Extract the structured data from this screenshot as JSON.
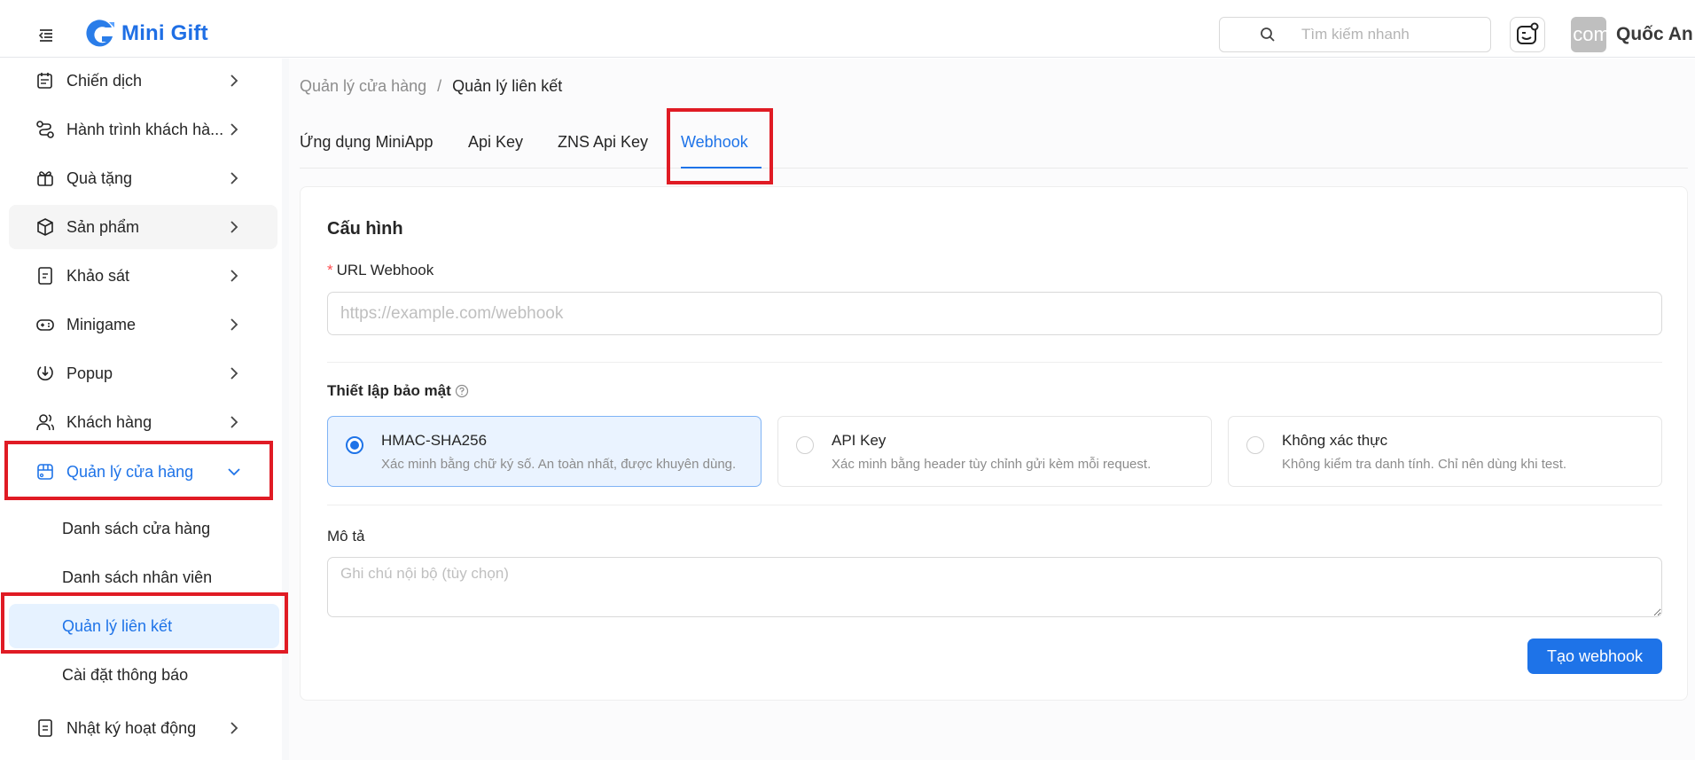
{
  "header": {
    "app_name": "Mini Gift",
    "search_placeholder": "Tìm kiếm nhanh",
    "avatar_text": "com",
    "user_name": "Quốc An"
  },
  "sidebar": {
    "items": [
      {
        "label": "Chiến dịch",
        "icon": "campaign-icon"
      },
      {
        "label": "Hành trình khách hà...",
        "icon": "journey-icon"
      },
      {
        "label": "Quà tặng",
        "icon": "gift-icon"
      },
      {
        "label": "Sản phẩm",
        "icon": "box-icon"
      },
      {
        "label": "Khảo sát",
        "icon": "survey-icon"
      },
      {
        "label": "Minigame",
        "icon": "gamepad-icon"
      },
      {
        "label": "Popup",
        "icon": "popup-icon"
      },
      {
        "label": "Khách hàng",
        "icon": "users-icon"
      },
      {
        "label": "Quản lý cửa hàng",
        "icon": "store-icon"
      },
      {
        "label": "Nhật ký hoạt động",
        "icon": "log-icon"
      }
    ],
    "sub_items": [
      {
        "label": "Danh sách cửa hàng"
      },
      {
        "label": "Danh sách nhân viên"
      },
      {
        "label": "Quản lý liên kết"
      },
      {
        "label": "Cài đặt thông báo"
      }
    ]
  },
  "breadcrumb": {
    "parent": "Quản lý cửa hàng",
    "separator": "/",
    "current": "Quản lý liên kết"
  },
  "tabs": [
    {
      "label": "Ứng dụng MiniApp"
    },
    {
      "label": "Api Key"
    },
    {
      "label": "ZNS Api Key"
    },
    {
      "label": "Webhook"
    }
  ],
  "form": {
    "title": "Cấu hình",
    "required_mark": "*",
    "url_label": "URL Webhook",
    "url_value": "",
    "url_placeholder": "https://example.com/webhook",
    "security_title": "Thiết lập bảo mật",
    "security_options": [
      {
        "title": "HMAC-SHA256",
        "desc": "Xác minh bằng chữ ký số. An toàn nhất, được khuyên dùng.",
        "selected": true
      },
      {
        "title": "API Key",
        "desc": "Xác minh bằng header tùy chỉnh gửi kèm mỗi request.",
        "selected": false
      },
      {
        "title": "Không xác thực",
        "desc": "Không kiểm tra danh tính. Chỉ nên dùng khi test.",
        "selected": false
      }
    ],
    "desc_label": "Mô tả",
    "desc_value": "",
    "desc_placeholder": "Ghi chú nội bộ (tùy chọn)",
    "submit_label": "Tạo webhook"
  },
  "colors": {
    "accent": "#1e73e8",
    "annotation": "#e01b24",
    "selected_bg": "#eaf3ff"
  }
}
